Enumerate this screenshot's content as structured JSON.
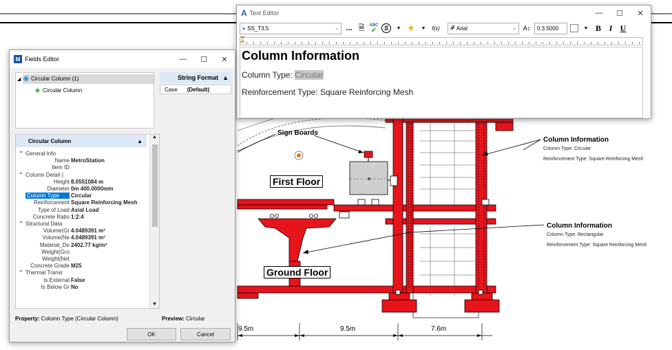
{
  "text_editor": {
    "title": "Text Editor",
    "style_name": "SS_T3.5",
    "font_name": "Arial",
    "text_size": "0:3.5000",
    "buttons": {
      "bold": "B",
      "italic": "I",
      "underline": "U",
      "more": "...",
      "function": "f(x)",
      "spell": "ABC"
    },
    "content": {
      "line1": "Column Information",
      "line2_prefix": "Column Type: ",
      "line2_field": "Circular",
      "line3": "Reinforcement Type: Square Reinforcing Mesh"
    }
  },
  "fields_editor": {
    "title": "Fields Editor",
    "tree": {
      "root": "Circular Column (1)",
      "child": "Circular Column"
    },
    "string_format": {
      "header": "String Format",
      "case_label": "Case",
      "case_value": "(Default)"
    },
    "properties_header": "Circular Column",
    "properties": [
      {
        "name": "General Info",
        "value": "",
        "group": true
      },
      {
        "name": "Name",
        "value": "MetroStation"
      },
      {
        "name": "Item ID",
        "value": ""
      },
      {
        "name": "Column Detail (",
        "value": "",
        "group": true
      },
      {
        "name": "Height",
        "value": "8.0551084 m"
      },
      {
        "name": "Diameter",
        "value": "0m 400.0000mm"
      },
      {
        "name": "Column Type",
        "value": "Circular",
        "selected": true
      },
      {
        "name": "Reinforcement",
        "value": "Square Reinforcing Mesh"
      },
      {
        "name": "Type of Load",
        "value": "Axial Load"
      },
      {
        "name": "Concrete Ratio",
        "value": "1:2:4"
      },
      {
        "name": "Structural Data",
        "value": "",
        "group": true
      },
      {
        "name": "Volume(Gr",
        "value": "4.0489391 m³"
      },
      {
        "name": "Volume(Ne",
        "value": "4.0489391 m³"
      },
      {
        "name": "Material_De",
        "value": "2402.77 kg/m³"
      },
      {
        "name": "Weight(Gro",
        "value": ""
      },
      {
        "name": "Weight(Net",
        "value": ""
      },
      {
        "name": "Concrete Grade",
        "value": "M25"
      },
      {
        "name": "Thermal Transr",
        "value": "",
        "group": true
      },
      {
        "name": "Is External",
        "value": "False"
      },
      {
        "name": "Is Below Gr",
        "value": "No"
      }
    ],
    "property_label": "Property:",
    "property_value": "Column Type (Circular Column)",
    "preview_label": "Preview:",
    "preview_value": "Circular",
    "ok_label": "OK",
    "cancel_label": "Cancel"
  },
  "drawing": {
    "sign_boards": "Sign Boards",
    "first_floor": "First Floor",
    "ground_floor": "Ground Floor",
    "annotation1": {
      "title": "Column Information",
      "line1": "Column Type: Circular",
      "line2": "Reinforcement Type: Square Reinforcing Mesh"
    },
    "annotation2": {
      "title": "Column Information",
      "line1": "Column Type: Rectangular",
      "line2": "Reinforcement Type: Square Reinforcing Mesh"
    },
    "dimensions": [
      "9.5m",
      "9.5m",
      "7.6m"
    ],
    "colors": {
      "structure": "#e8141c",
      "line": "#000000"
    }
  }
}
